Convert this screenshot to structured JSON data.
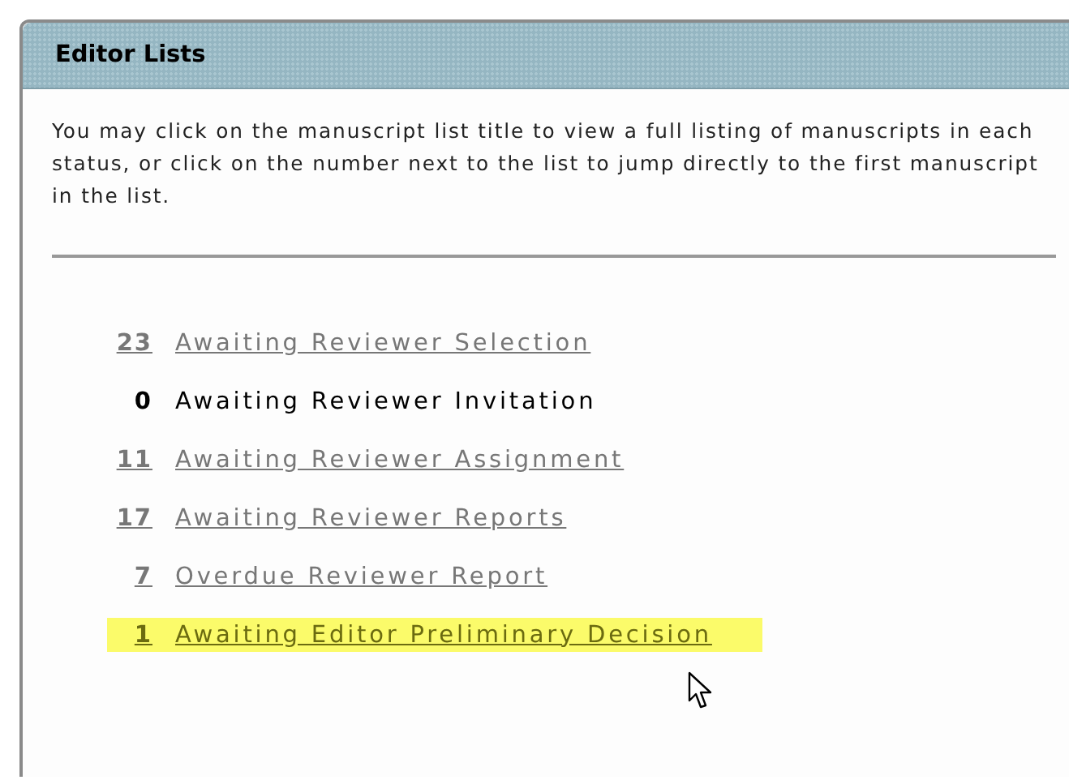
{
  "panel": {
    "title": "Editor Lists",
    "description": "You may click on the manuscript list title to view a full listing of manuscripts in each status, or click on the number next to the list to jump directly to the first manuscript in the list."
  },
  "lists": [
    {
      "count": "23",
      "label": "Awaiting Reviewer Selection",
      "kind": "link",
      "selected": false
    },
    {
      "count": "0",
      "label": "Awaiting Reviewer Invitation",
      "kind": "plain",
      "selected": false
    },
    {
      "count": "11",
      "label": "Awaiting Reviewer Assignment",
      "kind": "link",
      "selected": false
    },
    {
      "count": "17",
      "label": "Awaiting Reviewer Reports",
      "kind": "link",
      "selected": false
    },
    {
      "count": "7",
      "label": "Overdue Reviewer Report",
      "kind": "link",
      "selected": false
    },
    {
      "count": "1",
      "label": "Awaiting Editor Preliminary Decision",
      "kind": "link",
      "selected": true
    }
  ]
}
